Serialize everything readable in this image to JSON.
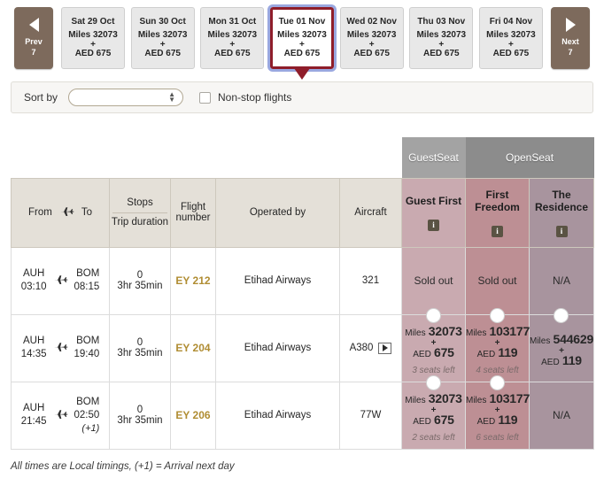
{
  "datestrip": {
    "prev": {
      "label": "Prev",
      "count": "7",
      "icon": "triangle-left-icon"
    },
    "next": {
      "label": "Next",
      "count": "7",
      "icon": "triangle-right-icon"
    },
    "dates": [
      {
        "day": "Sat 29 Oct",
        "miles": "Miles 32073",
        "plus": "+",
        "cash": "AED 675",
        "selected": false
      },
      {
        "day": "Sun 30 Oct",
        "miles": "Miles 32073",
        "plus": "+",
        "cash": "AED 675",
        "selected": false
      },
      {
        "day": "Mon 31 Oct",
        "miles": "Miles 32073",
        "plus": "+",
        "cash": "AED 675",
        "selected": false
      },
      {
        "day": "Tue 01 Nov",
        "miles": "Miles 32073",
        "plus": "+",
        "cash": "AED 675",
        "selected": true
      },
      {
        "day": "Wed 02 Nov",
        "miles": "Miles 32073",
        "plus": "+",
        "cash": "AED 675",
        "selected": false
      },
      {
        "day": "Thu 03 Nov",
        "miles": "Miles 32073",
        "plus": "+",
        "cash": "AED 675",
        "selected": false
      },
      {
        "day": "Fri 04 Nov",
        "miles": "Miles 32073",
        "plus": "+",
        "cash": "AED 675",
        "selected": false
      }
    ]
  },
  "sortbar": {
    "label": "Sort by",
    "select_value": "",
    "select_placeholder": "",
    "nonstop_label": "Non-stop flights",
    "nonstop_checked": false
  },
  "table": {
    "group_headers": {
      "blank": "",
      "guestseat": "GuestSeat",
      "openseat": "OpenSeat"
    },
    "columns": {
      "from": "From",
      "to": "To",
      "stops": "Stops",
      "trip_duration": "Trip duration",
      "flight_number": "Flight number",
      "operated_by": "Operated by",
      "aircraft": "Aircraft"
    },
    "fare_columns": [
      {
        "name": "Guest First",
        "info": "i",
        "group": "GuestSeat"
      },
      {
        "name": "First Freedom",
        "info": "i",
        "group": "OpenSeat"
      },
      {
        "name": "The Residence",
        "info": "i",
        "group": "OpenSeat"
      }
    ],
    "rows": [
      {
        "from_code": "AUH",
        "from_time": "03:10",
        "to_code": "BOM",
        "to_time": "08:15",
        "to_next_day": "",
        "stops": "0",
        "duration": "3hr 35min",
        "flight_number": "EY 212",
        "operated_by": "Etihad Airways",
        "aircraft": "321",
        "aircraft_video": false,
        "fares": [
          {
            "state": "soldout",
            "text": "Sold out"
          },
          {
            "state": "soldout",
            "text": "Sold out"
          },
          {
            "state": "na",
            "text": "N/A"
          }
        ]
      },
      {
        "from_code": "AUH",
        "from_time": "14:35",
        "to_code": "BOM",
        "to_time": "19:40",
        "to_next_day": "",
        "stops": "0",
        "duration": "3hr 35min",
        "flight_number": "EY 204",
        "operated_by": "Etihad Airways",
        "aircraft": "A380",
        "aircraft_video": true,
        "fares": [
          {
            "state": "price",
            "miles_label": "Miles",
            "miles": "32073",
            "plus": "+",
            "cash_label": "AED",
            "cash": "675",
            "seats": "3 seats left"
          },
          {
            "state": "price",
            "miles_label": "Miles",
            "miles": "103177",
            "plus": "+",
            "cash_label": "AED",
            "cash": "119",
            "seats": "4 seats left"
          },
          {
            "state": "price",
            "miles_label": "Miles",
            "miles": "544629",
            "plus": "+",
            "cash_label": "AED",
            "cash": "119",
            "seats": ""
          }
        ]
      },
      {
        "from_code": "AUH",
        "from_time": "21:45",
        "to_code": "BOM",
        "to_time": "02:50",
        "to_next_day": "(+1)",
        "stops": "0",
        "duration": "3hr 35min",
        "flight_number": "EY 206",
        "operated_by": "Etihad Airways",
        "aircraft": "77W",
        "aircraft_video": false,
        "fares": [
          {
            "state": "price",
            "miles_label": "Miles",
            "miles": "32073",
            "plus": "+",
            "cash_label": "AED",
            "cash": "675",
            "seats": "2 seats left"
          },
          {
            "state": "price",
            "miles_label": "Miles",
            "miles": "103177",
            "plus": "+",
            "cash_label": "AED",
            "cash": "119",
            "seats": "6 seats left"
          },
          {
            "state": "na",
            "text": "N/A"
          }
        ]
      }
    ]
  },
  "footnote": "All times are Local timings, (+1) = Arrival next day",
  "colors": {
    "nav_button": "#7d6a5c",
    "selected_date_border": "#8f1d2a",
    "selected_date_glow": "#9aa8e0",
    "flight_number": "#b08d33",
    "guestseat_header": "#a3a3a3",
    "openseat_header": "#8c8c8c",
    "guest_first_cell": "#c9aab0",
    "first_freedom_cell": "#bd8f94",
    "residence_cell": "#a8949e",
    "info_badge": "#5a5343"
  }
}
